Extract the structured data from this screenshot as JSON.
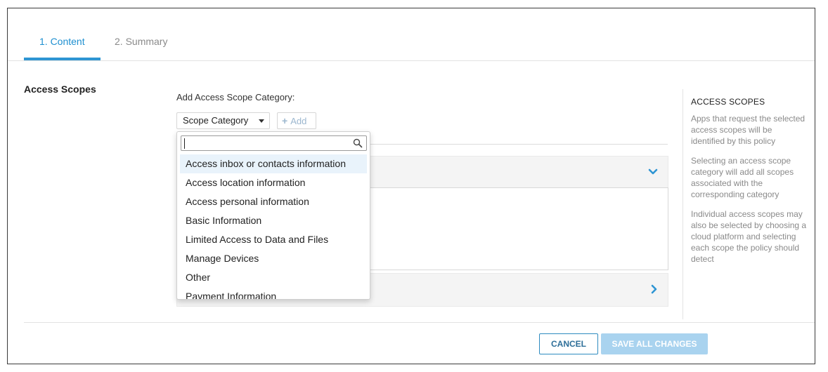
{
  "tabs": [
    {
      "label": "1. Content",
      "active": true
    },
    {
      "label": "2. Summary",
      "active": false
    }
  ],
  "section": {
    "title": "Access Scopes"
  },
  "form": {
    "add_label": "Add Access Scope Category:",
    "select_value": "Scope Category",
    "add_button": "Add"
  },
  "dropdown": {
    "search_value": "",
    "items": [
      "Access inbox or contacts information",
      "Access location information",
      "Access personal information",
      "Basic Information",
      "Limited Access to Data and Files",
      "Manage Devices",
      "Other",
      "Payment Information"
    ],
    "highlighted_index": 0
  },
  "info": {
    "title": "ACCESS SCOPES",
    "paragraphs": [
      "Apps that request the selected access scopes will be identified by this policy",
      "Selecting an access scope category will add all scopes associated with the corresponding category",
      "Individual access scopes may also be selected by choosing a cloud platform and selecting each scope the policy should detect"
    ]
  },
  "footer": {
    "cancel_label": "CANCEL",
    "save_label": "SAVE ALL CHANGES"
  },
  "colors": {
    "accent": "#2e95d3",
    "save_disabled": "#a9d3ef",
    "chevron": "#2e95d3"
  },
  "icons": {
    "chevron_down": "chevron-down-icon",
    "chevron_right": "chevron-right-icon",
    "search": "search-icon",
    "plus": "plus-icon",
    "caret": "caret-down-icon"
  }
}
